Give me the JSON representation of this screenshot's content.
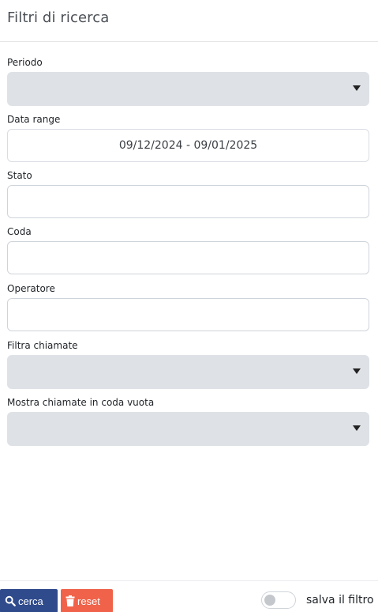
{
  "header": {
    "title": "Filtri di ricerca"
  },
  "fields": {
    "periodo": {
      "label": "Periodo",
      "value": ""
    },
    "data_range": {
      "label": "Data range",
      "value": "09/12/2024 - 09/01/2025"
    },
    "stato": {
      "label": "Stato",
      "value": ""
    },
    "coda": {
      "label": "Coda",
      "value": ""
    },
    "operatore": {
      "label": "Operatore",
      "value": ""
    },
    "filtra_chiamate": {
      "label": "Filtra chiamate",
      "value": ""
    },
    "mostra_coda_vuota": {
      "label": "Mostra chiamate in coda vuota",
      "value": ""
    }
  },
  "footer": {
    "search_label": "cerca",
    "reset_label": "reset",
    "save_filter_label": "salva il filtro",
    "save_filter_on": false
  },
  "colors": {
    "search_button": "#2f4b8c",
    "reset_button": "#f0634a",
    "select_bg": "#dee1e5"
  },
  "icons": {
    "search": "search-icon",
    "reset": "trash-icon",
    "dropdown": "caret-down-icon"
  }
}
